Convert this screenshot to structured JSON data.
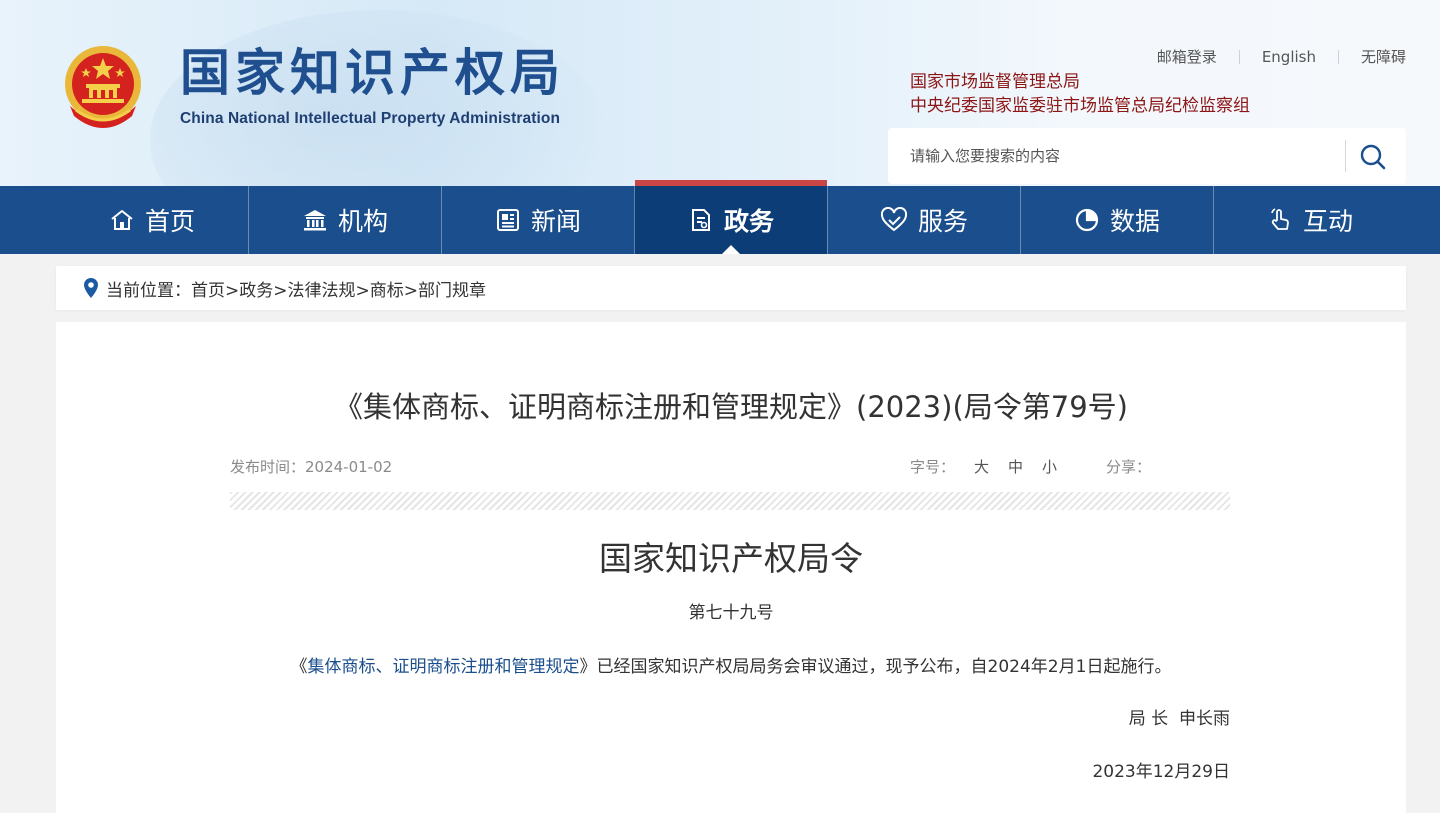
{
  "header": {
    "logo_cn": "国家知识产权局",
    "logo_en": "China National Intellectual Property Administration",
    "top_links": [
      "邮箱登录",
      "English",
      "无障碍"
    ],
    "org_links": [
      "国家市场监督管理总局",
      "中央纪委国家监委驻市场监管总局纪检监察组"
    ],
    "search_placeholder": "请输入您要搜索的内容",
    "icons": {
      "emblem": "national-emblem-icon",
      "search": "search-icon"
    },
    "colors": {
      "brand_blue": "#1f4f8f",
      "org_red": "#8c1515"
    }
  },
  "nav": {
    "items": [
      {
        "label": "首页",
        "icon": "home-icon"
      },
      {
        "label": "机构",
        "icon": "institution-icon"
      },
      {
        "label": "新闻",
        "icon": "news-icon"
      },
      {
        "label": "政务",
        "icon": "document-icon"
      },
      {
        "label": "服务",
        "icon": "service-icon"
      },
      {
        "label": "数据",
        "icon": "pie-chart-icon"
      },
      {
        "label": "互动",
        "icon": "hand-pointer-icon"
      }
    ],
    "active": "政务",
    "colors": {
      "bar": "#1b4e8d",
      "active": "#0d3d76",
      "active_top": "#c94546"
    }
  },
  "breadcrumb": {
    "icon": "location-pin-icon",
    "text": "当前位置：首页>政务>法律法规>商标>部门规章"
  },
  "article": {
    "title": "《集体商标、证明商标注册和管理规定》(2023)(局令第79号)",
    "publish_date": "发布时间：2024-01-02",
    "font_size_label": "字号：",
    "font_sizes": [
      "大",
      "中",
      "小"
    ],
    "share_label": "分享：",
    "doc_title": "国家知识产权局令",
    "doc_number": "第七十九号",
    "body_open": "《",
    "body_link": "集体商标、证明商标注册和管理规定",
    "body_rest": "》已经国家知识产权局局务会审议通过，现予公布，自2024年2月1日起施行。",
    "signer": "局 长  申长雨",
    "sign_date": "2023年12月29日"
  }
}
